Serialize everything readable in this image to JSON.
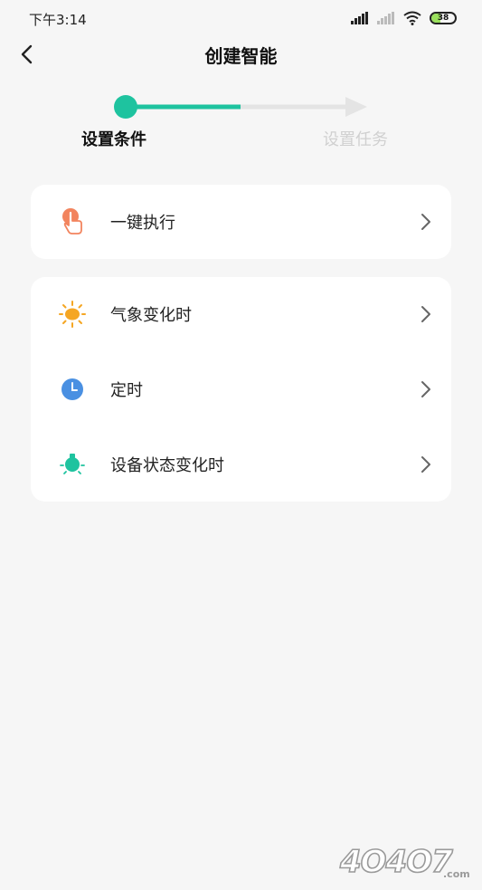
{
  "status": {
    "time": "下午3:14",
    "battery": "38"
  },
  "header": {
    "title": "创建智能"
  },
  "steps": [
    {
      "label": "设置条件",
      "active": true
    },
    {
      "label": "设置任务",
      "active": false
    }
  ],
  "colors": {
    "accent": "#1ec39f",
    "inactive": "#d8d8d8"
  },
  "cards": [
    {
      "items": [
        {
          "label": "一键执行",
          "icon": "hand-tap-icon"
        }
      ]
    },
    {
      "items": [
        {
          "label": "气象变化时",
          "icon": "sun-icon"
        },
        {
          "label": "定时",
          "icon": "clock-icon"
        },
        {
          "label": "设备状态变化时",
          "icon": "device-bulb-icon"
        }
      ]
    }
  ],
  "watermark": "4O4O7.com"
}
